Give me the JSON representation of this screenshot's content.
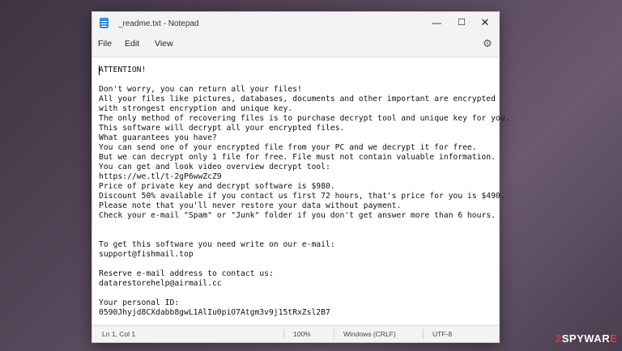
{
  "window": {
    "title": "_readme.txt - Notepad",
    "minimize_glyph": "—",
    "maximize_glyph": "☐",
    "close_glyph": "✕"
  },
  "menu": {
    "file": "File",
    "edit": "Edit",
    "view": "View"
  },
  "icons": {
    "app": "notepad-icon",
    "settings": "gear-icon"
  },
  "editor": {
    "text": "ATTENTION!\n\nDon't worry, you can return all your files!\nAll your files like pictures, databases, documents and other important are encrypted\nwith strongest encryption and unique key.\nThe only method of recovering files is to purchase decrypt tool and unique key for you.\nThis software will decrypt all your encrypted files.\nWhat guarantees you have?\nYou can send one of your encrypted file from your PC and we decrypt it for free.\nBut we can decrypt only 1 file for free. File must not contain valuable information.\nYou can get and look video overview decrypt tool:\nhttps://we.tl/t-2gP6wwZcZ9\nPrice of private key and decrypt software is $980.\nDiscount 50% available if you contact us first 72 hours, that's price for you is $490.\nPlease note that you'll never restore your data without payment.\nCheck your e-mail \"Spam\" or \"Junk\" folder if you don't get answer more than 6 hours.\n\n\nTo get this software you need write on our e-mail:\nsupport@fishmail.top\n\nReserve e-mail address to contact us:\ndatarestorehelp@airmail.cc\n\nYour personal ID:\n0590Jhyjd8CXdabb8gwL1AlIu0piO7Atgm3v9j15tRxZsl2B7"
  },
  "statusbar": {
    "position": "Ln 1, Col 1",
    "zoom": "100%",
    "line_ending": "Windows (CRLF)",
    "encoding": "UTF-8"
  },
  "watermark": {
    "prefix": "2",
    "rest": "SPYWAR",
    "accent": "E"
  }
}
